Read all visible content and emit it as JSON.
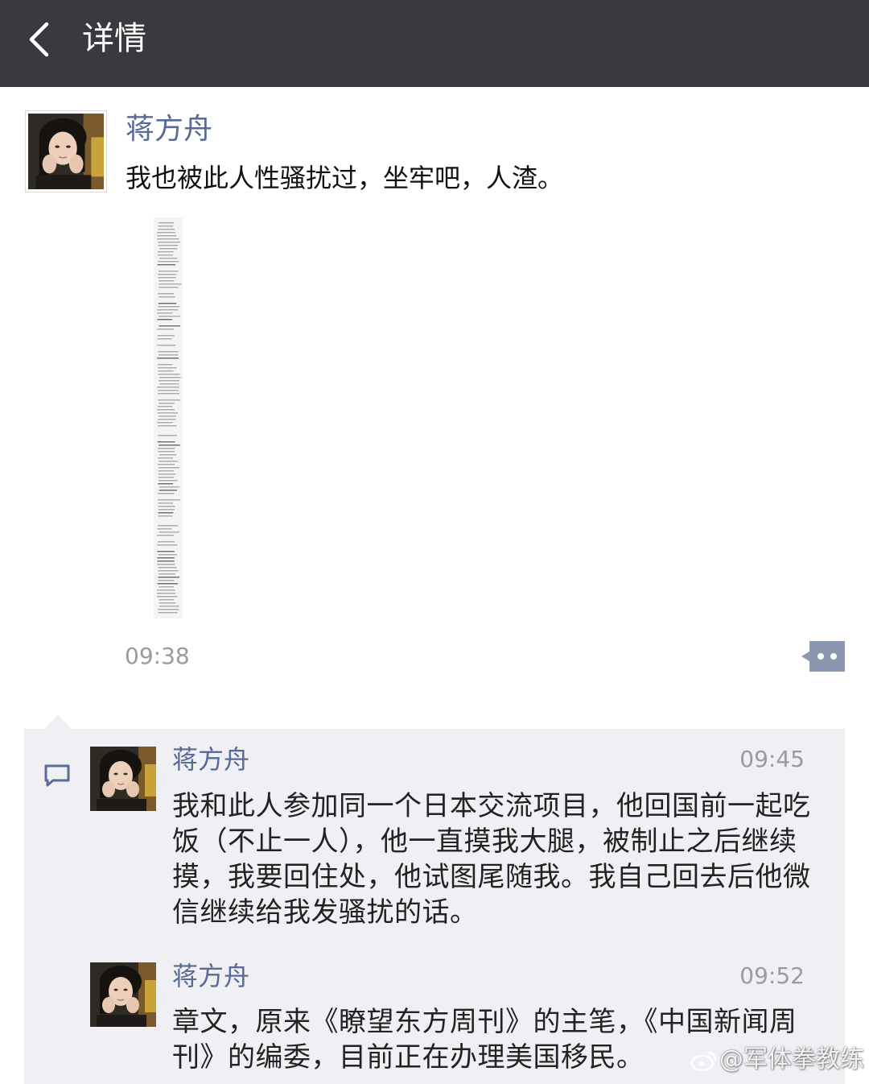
{
  "header": {
    "title": "详情",
    "background": "#393a3f"
  },
  "post": {
    "author": "蒋方舟",
    "text": "我也被此人性骚扰过，坐牢吧，人渣。",
    "time": "09:38"
  },
  "comments": [
    {
      "author": "蒋方舟",
      "time": "09:45",
      "text": "我和此人参加同一个日本交流项目，他回国前一起吃饭（不止一人），他一直摸我大腿，被制止之后继续摸，我要回住处，他试图尾随我。我自己回去后他微信继续给我发骚扰的话。"
    },
    {
      "author": "蒋方舟",
      "time": "09:52",
      "text": "章文，原来《瞭望东方周刊》的主笔，《中国新闻周刊》的编委，目前正在办理美国移民。"
    }
  ],
  "watermark": "@军体拳教练",
  "colors": {
    "name_link": "#576b95",
    "comment_bg": "#efeff4",
    "time_gray": "#9b9b9b"
  },
  "icons": {
    "back": "chevron-left-icon",
    "more": "more-dots-icon",
    "comment": "comment-bubble-icon",
    "watermark_logo": "weibo-icon"
  }
}
